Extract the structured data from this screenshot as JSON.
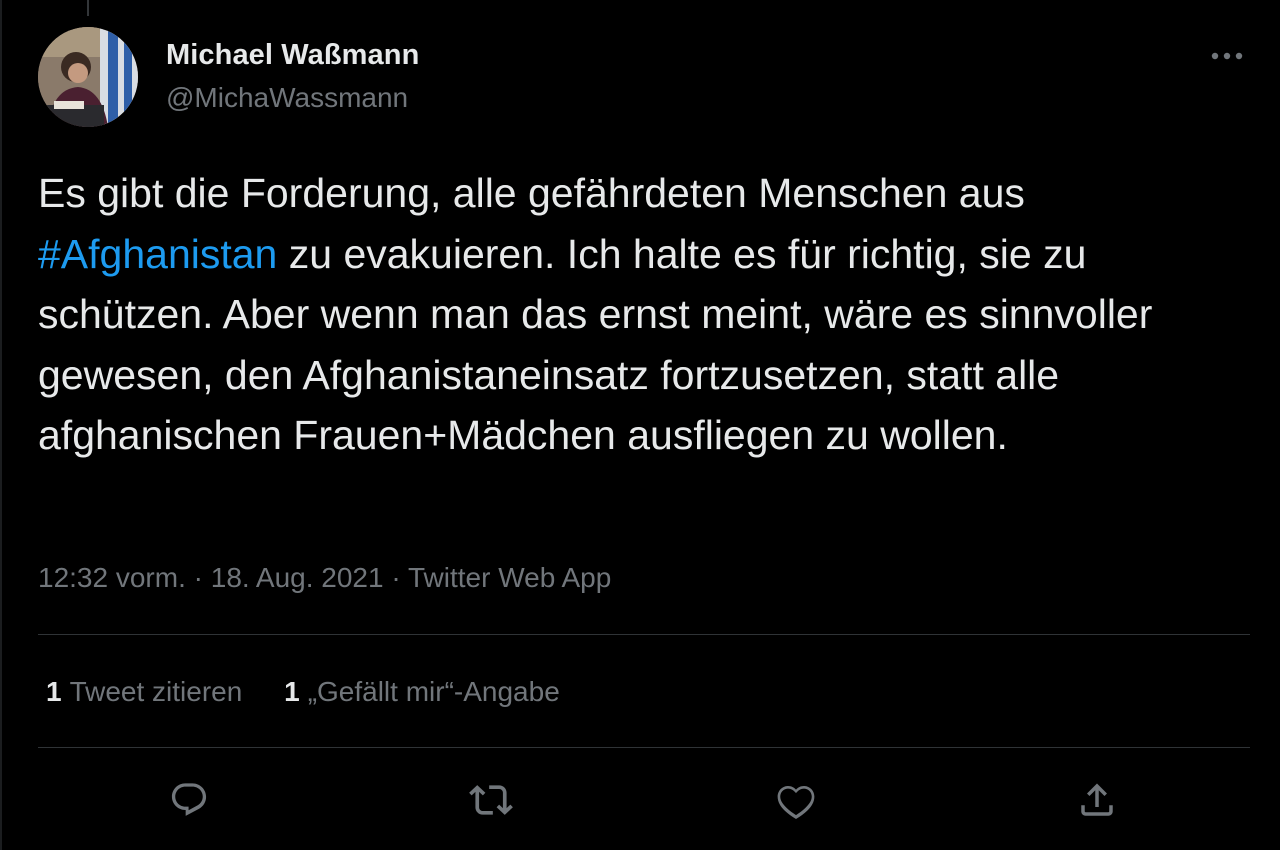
{
  "tweet": {
    "author": {
      "display_name": "Michael Waßmann",
      "handle": "@MichaWassmann"
    },
    "text_segments": {
      "part1": "Es gibt die Forderung, alle gefährdeten Menschen aus ",
      "hashtag": "#Afghanistan",
      "part2": " zu evakuieren. Ich halte es für richtig, sie zu schützen. Aber wenn man das ernst meint, wäre es sinnvoller gewesen, den Afghanistaneinsatz fortzusetzen, statt alle afghanischen Frauen+Mädchen ausfliegen zu wollen."
    },
    "meta": {
      "time": "12:32 vorm.",
      "separator": " · ",
      "date": "18. Aug. 2021",
      "source": "Twitter Web App"
    },
    "stats": {
      "quotes_count": "1",
      "quotes_label": "Tweet zitieren",
      "likes_count": "1",
      "likes_label": "„Gefällt mir“-Angabe"
    }
  },
  "icons": {
    "more": "more-horizontal-icon",
    "reply": "reply-icon",
    "retweet": "retweet-icon",
    "like": "like-icon",
    "share": "share-icon"
  },
  "colors": {
    "background": "#000000",
    "text": "#e7e9ea",
    "secondary": "#71767b",
    "accent": "#1d9bf0",
    "divider": "#2f3336"
  }
}
